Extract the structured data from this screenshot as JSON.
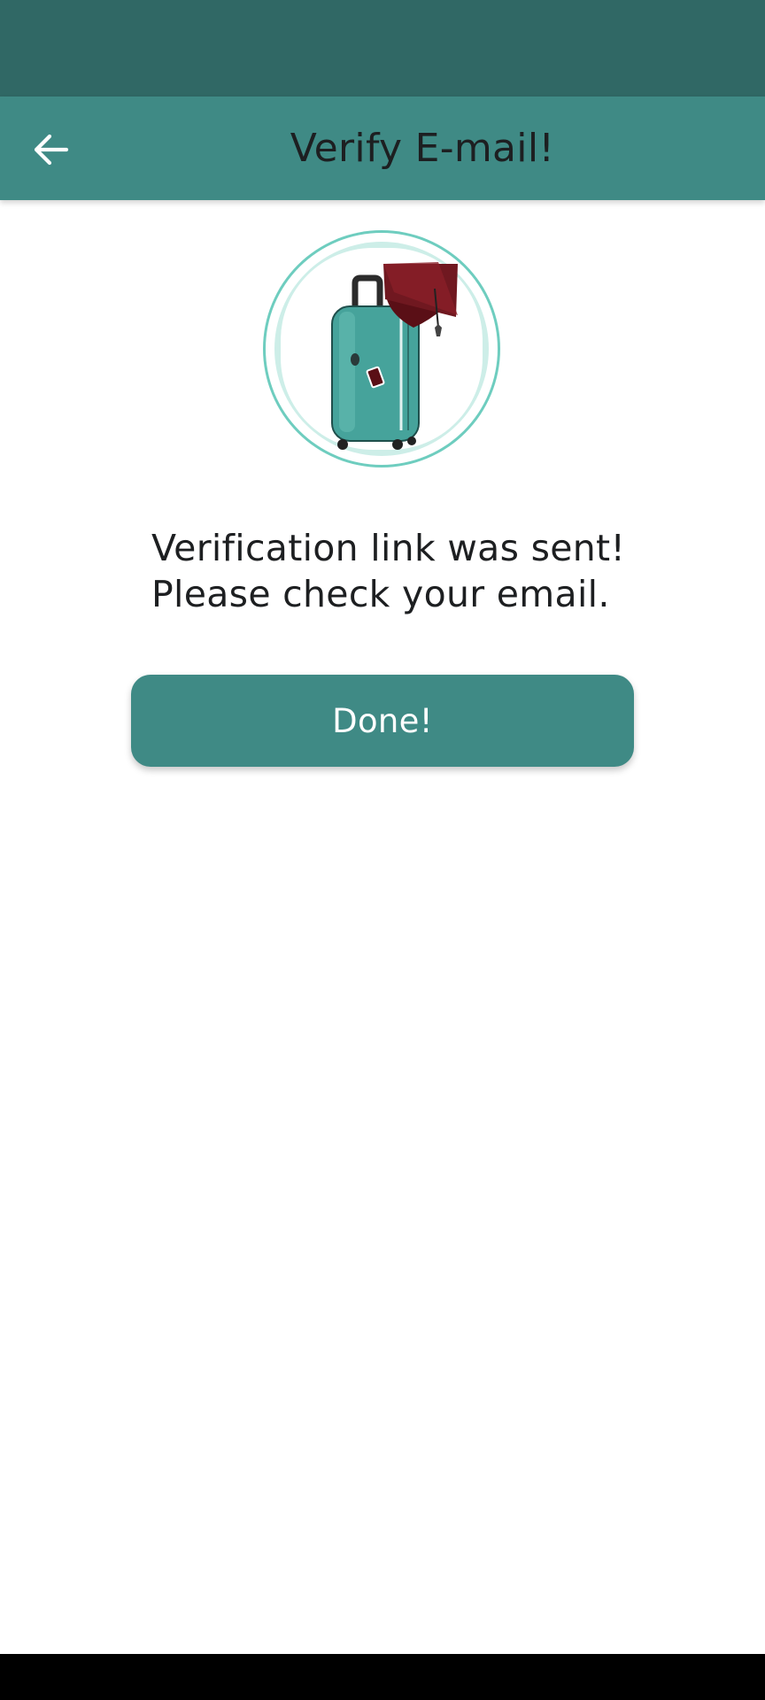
{
  "colors": {
    "status_bar": "#306865",
    "app_bar": "#3f8a85",
    "button": "#3f8a85",
    "avatar_ring": "#6ecdbf",
    "avatar_inner": "#cdeee8",
    "suitcase": "#46a39b",
    "cap": "#701820",
    "nav_bar": "#000000"
  },
  "app_bar": {
    "back_icon": "arrow-left-icon",
    "title": "Verify E-mail!"
  },
  "main": {
    "illustration": "suitcase-with-graduation-cap",
    "message_line1": "Verification link was sent!",
    "message_line2": "Please check your email.",
    "done_label": "Done!"
  }
}
